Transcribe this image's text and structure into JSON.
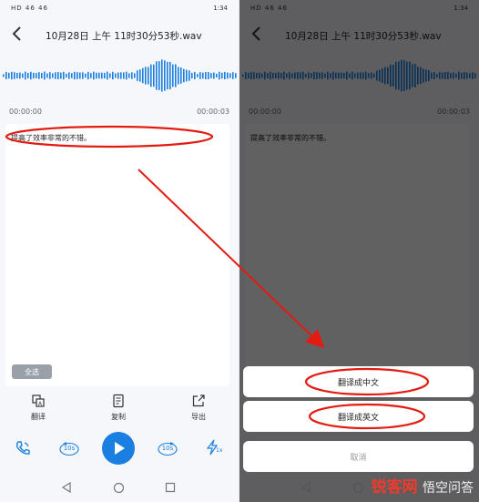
{
  "status": {
    "left": "HD 46 46",
    "time": "1:34"
  },
  "header": {
    "title": "10月28日 上午 11时30分53秒.wav"
  },
  "timeline": {
    "start": "00:00:00",
    "end": "00:00:03"
  },
  "transcript": "提高了效率非常的不错。",
  "select_all": "全选",
  "toolbar": {
    "translate": "翻译",
    "copy": "复制",
    "export": "导出"
  },
  "player": {
    "skip": "10s",
    "speed": "1x"
  },
  "sheet": {
    "to_chinese": "翻译成中文",
    "to_english": "翻译成英文",
    "cancel": "取消"
  },
  "watermark": {
    "brand": "锐客网",
    "sub": "悟空问答"
  },
  "colors": {
    "accent": "#1a7fe0",
    "annotation": "#e31b12"
  }
}
